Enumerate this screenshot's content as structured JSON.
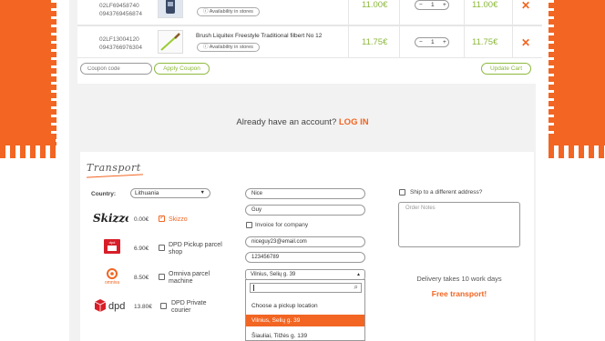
{
  "cart": {
    "rows": [
      {
        "code1": "02LF69458740",
        "code2": "0943769456874",
        "name": "",
        "availability": "Availability in stores",
        "unit_price": "11.00€",
        "qty": "1",
        "total": "11.00€"
      },
      {
        "code1": "02LF13004120",
        "code2": "0943766976304",
        "name": "Brush Liquitex Freestyle Traditional filbert No 12",
        "availability": "Availability in stores",
        "unit_price": "11.75€",
        "qty": "1",
        "total": "11.75€"
      }
    ],
    "qty_minus": "−",
    "qty_plus": "+",
    "remove_icon": "✕",
    "coupon_placeholder": "Coupon code",
    "apply_coupon": "Apply Coupon",
    "update_cart": "Update Cart"
  },
  "account": {
    "prompt": "Already have an account?",
    "login": "LOG IN"
  },
  "transport": {
    "title": "Transport",
    "country_label": "Country:",
    "country_value": "Lithuania",
    "carriers": [
      {
        "logo_icon": "skizzo-logo",
        "logo_text": "Skizzo",
        "price": "0.00€",
        "name": "Skizzo",
        "checked": true
      },
      {
        "logo_icon": "dpd-pickup-logo",
        "logo_text": "dpd",
        "price": "6.90€",
        "name": "DPD Pickup parcel shop",
        "checked": false
      },
      {
        "logo_icon": "omniva-logo",
        "logo_text": "omniva",
        "price": "8.50€",
        "name": "Omniva parcel machine",
        "checked": false
      },
      {
        "logo_icon": "dpd-logo",
        "logo_text": "dpd",
        "price": "13.80€",
        "name": "DPD Private courier",
        "checked": false
      }
    ],
    "first_name": "Nice",
    "last_name": "Guy",
    "invoice_label": "Invoice for company",
    "email": "niceguy23@email.com",
    "phone": "123456789",
    "pickup_selected": "Vilnius, Selių g. 39",
    "dropdown_items": [
      "Choose a pickup location",
      "Vilnius, Selių g. 39",
      "Šiauliai, Tilžės g. 139"
    ],
    "ship_different": "Ship to a different address?",
    "notes_placeholder": "Order Notes",
    "delivery_text": "Delivery takes 10 work days",
    "free_transport": "Free transport!"
  },
  "colors": {
    "accent": "#f26522",
    "green": "#8cb83c"
  }
}
